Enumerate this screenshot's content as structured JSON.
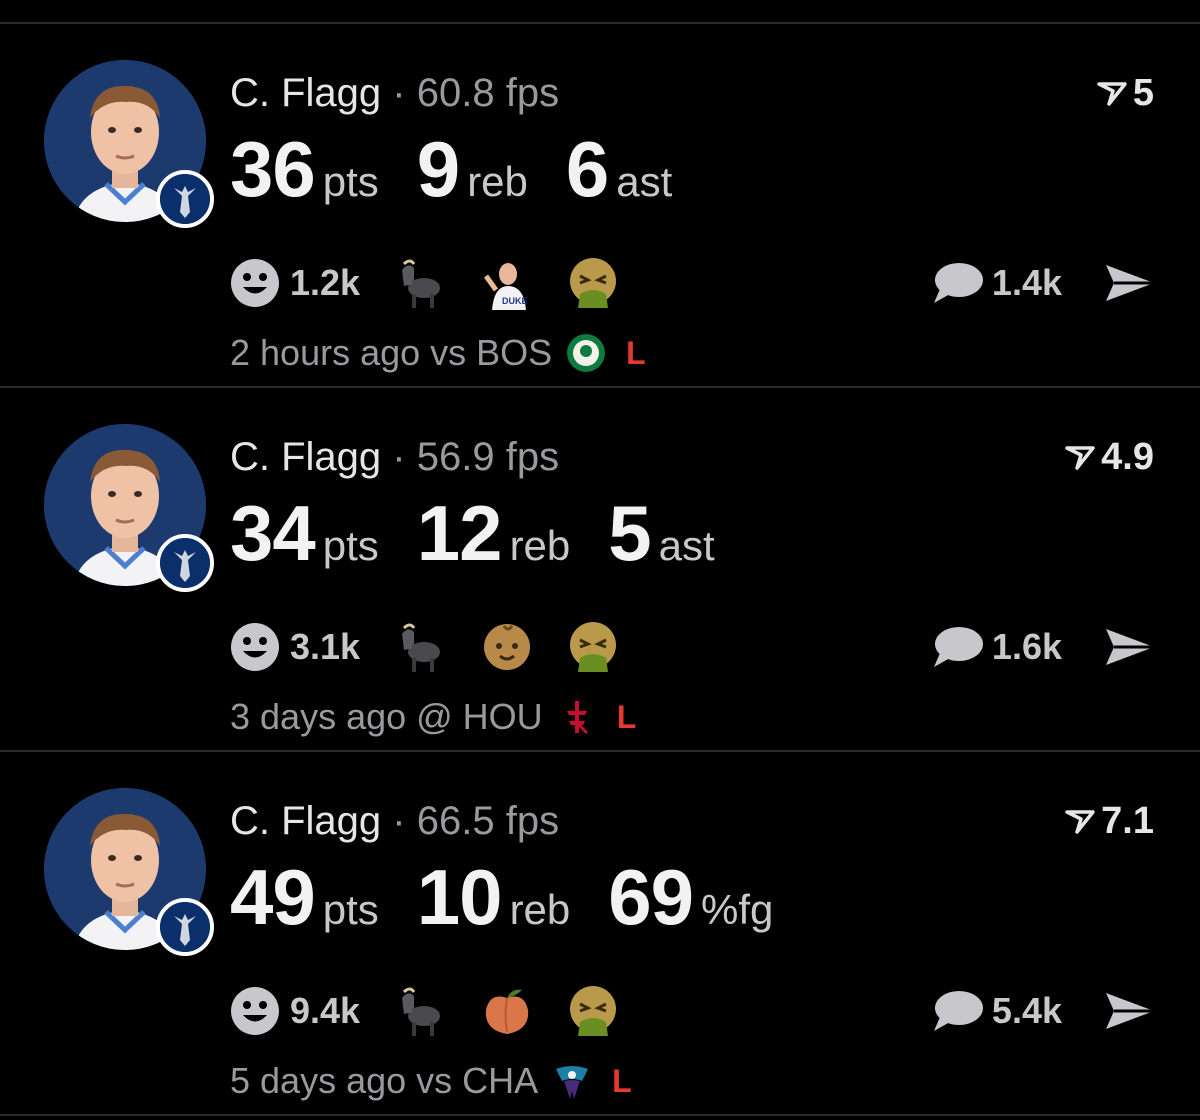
{
  "colors": {
    "background": "#000000",
    "divider": "#2a2a2c",
    "loss": "#e5392f",
    "muted": "#9a9a9e"
  },
  "cards": [
    {
      "player": "C. Flagg",
      "sep": "·",
      "fps": "60.8 fps",
      "rating": "5",
      "stats": [
        {
          "value": "36",
          "unit": "pts"
        },
        {
          "value": "9",
          "unit": "reb"
        },
        {
          "value": "6",
          "unit": "ast"
        }
      ],
      "smile_count": "1.2k",
      "emojis": [
        "goat-icon",
        "player-photo-icon",
        "nauseated-face-icon"
      ],
      "comment_count": "1.4k",
      "time_text": "2 hours ago vs BOS",
      "opponent_icon": "celtics-logo-icon",
      "result": "L"
    },
    {
      "player": "C. Flagg",
      "sep": "·",
      "fps": "56.9 fps",
      "rating": "4.9",
      "stats": [
        {
          "value": "34",
          "unit": "pts"
        },
        {
          "value": "12",
          "unit": "reb"
        },
        {
          "value": "5",
          "unit": "ast"
        }
      ],
      "smile_count": "3.1k",
      "emojis": [
        "goat-icon",
        "baby-icon",
        "nauseated-face-icon"
      ],
      "comment_count": "1.6k",
      "time_text": "3 days ago @ HOU",
      "opponent_icon": "rockets-logo-icon",
      "result": "L"
    },
    {
      "player": "C. Flagg",
      "sep": "·",
      "fps": "66.5 fps",
      "rating": "7.1",
      "stats": [
        {
          "value": "49",
          "unit": "pts"
        },
        {
          "value": "10",
          "unit": "reb"
        },
        {
          "value": "69",
          "unit": "%fg"
        }
      ],
      "smile_count": "9.4k",
      "emojis": [
        "goat-icon",
        "peach-icon",
        "nauseated-face-icon"
      ],
      "comment_count": "5.4k",
      "time_text": "5 days ago vs CHA",
      "opponent_icon": "hornets-logo-icon",
      "result": "L"
    }
  ]
}
